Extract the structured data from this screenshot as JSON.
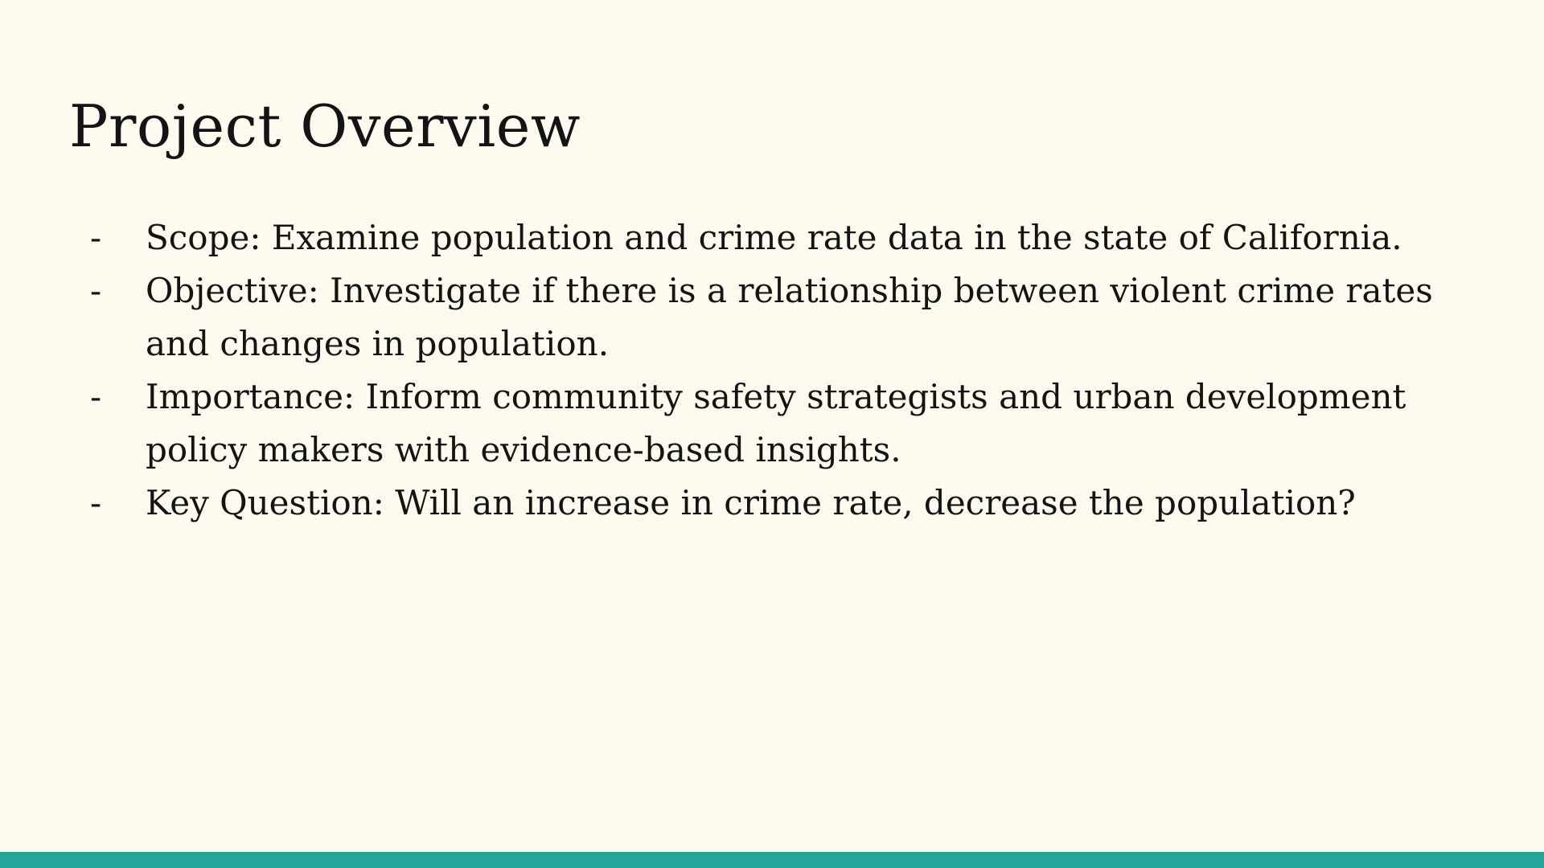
{
  "slide": {
    "title": "Project Overview",
    "bullets": [
      {
        "marker": "-",
        "text": "Scope: Examine population and crime rate data in the state of California."
      },
      {
        "marker": "-",
        "text": "Objective: Investigate if there is a relationship between violent crime rates and changes in population."
      },
      {
        "marker": "-",
        "text": "Importance: Inform community safety strategists and urban development policy makers with evidence-based insights."
      },
      {
        "marker": "-",
        "text": "Key Question: Will an increase in crime rate, decrease the population?"
      }
    ]
  },
  "colors": {
    "background": "#FEFAF0",
    "text": "#141414",
    "accent_bar": "#26A69A"
  }
}
